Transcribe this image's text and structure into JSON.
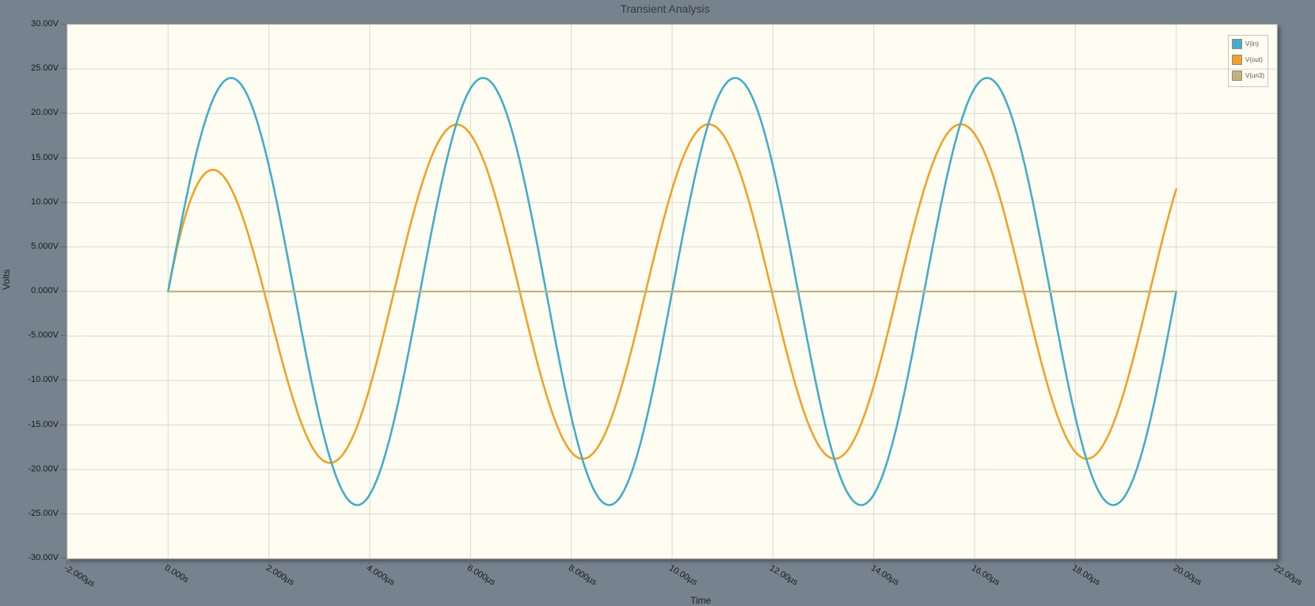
{
  "title": "Transient Analysis",
  "colors": {
    "background": "#76828e",
    "plot_background": "#fffdf2",
    "grid": "#d8d8d4",
    "tick": "#66665f",
    "text": "#1b1c1e",
    "vin": "#44adc8",
    "vout": "#f0a227",
    "vun3": "#c2b280"
  },
  "chart_data": {
    "type": "line",
    "title": "Transient Analysis",
    "xlabel": "Time",
    "ylabel": "Volts",
    "x_unit": "µs",
    "y_unit": "V",
    "xlim": [
      -2,
      22
    ],
    "ylim": [
      -30,
      30
    ],
    "x_tick_step": 2,
    "y_tick_step": 5,
    "grid": true,
    "legend_position": "top-right",
    "x_tick_labels": [
      "-2.000µs",
      "0.000s",
      "2.000µs",
      "4.000µs",
      "6.000µs",
      "8.000µs",
      "10.00µs",
      "12.00µs",
      "14.00µs",
      "16.00µs",
      "18.00µs",
      "20.00µs",
      "22.00µs"
    ],
    "y_tick_labels": [
      "30.00V",
      "25.00V",
      "20.00V",
      "15.00V",
      "10.00V",
      "5.000V",
      "0.000V",
      "-5.000V",
      "-10.00V",
      "-15.00V",
      "-20.00V",
      "-25.00V",
      "-30.00V"
    ],
    "series": [
      {
        "name": "V(in)",
        "color": "#44adc8",
        "model": "sine",
        "amplitude_v": 24,
        "period_us": 5,
        "phase_rad": 0,
        "t_start_us": 0,
        "t_end_us": 20,
        "peaks_v": 24.0,
        "peak_times_us": [
          1.25,
          6.25,
          11.25,
          16.25
        ],
        "trough_times_us": [
          3.75,
          8.75,
          13.75,
          18.75
        ],
        "end_value_v": 0,
        "stroke_width": 2.6,
        "z": 2
      },
      {
        "name": "V(out)",
        "color": "#f0a227",
        "model": "sine_with_transient",
        "amplitude_v": 18.8,
        "period_us": 5,
        "phase_rad": 0.658,
        "transient_amp_v": -11.5,
        "transient_tau_us": 1.0,
        "t_start_us": 0,
        "t_end_us": 20,
        "first_peak": {
          "t_us": 0.85,
          "v": 13.5
        },
        "steady_state_peak_v": 18.8,
        "end_value_v": 11.5,
        "stroke_width": 2.6,
        "z": 1
      },
      {
        "name": "V(un3)",
        "color": "#c2b280",
        "model": "constant",
        "value_v": 0,
        "t_start_us": 0,
        "t_end_us": 20,
        "stroke_width": 2.2,
        "z": 3
      }
    ]
  }
}
